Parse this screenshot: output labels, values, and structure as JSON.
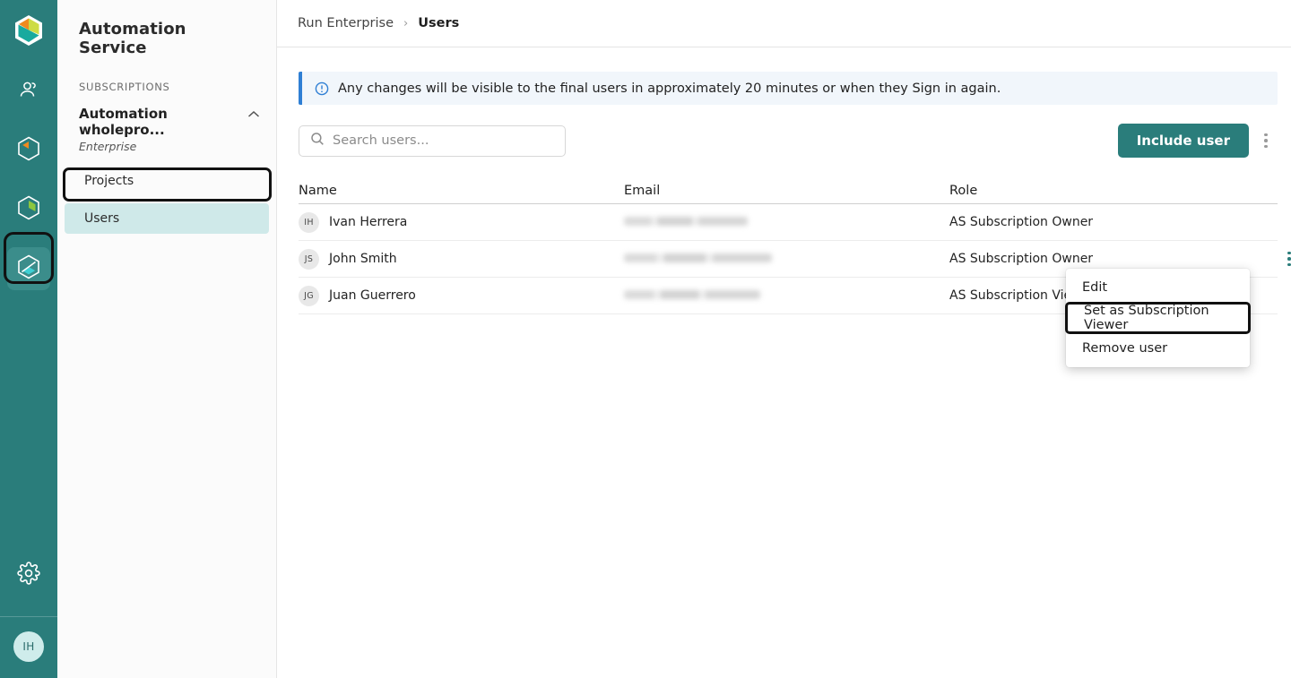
{
  "rail": {
    "logo_icon": "hexagon-logo-icon",
    "items": [
      {
        "name": "people-icon",
        "active": false
      },
      {
        "name": "hexagon-orange-icon",
        "active": false
      },
      {
        "name": "hexagon-green-icon",
        "active": false
      },
      {
        "name": "hexagon-teal-icon",
        "active": true
      }
    ],
    "settings_icon": "gear-icon",
    "avatar_initials": "IH"
  },
  "sidebar": {
    "title": "Automation Service",
    "section_label": "SUBSCRIPTIONS",
    "subscription": {
      "name": "Automation wholepro...",
      "plan": "Enterprise",
      "chevron": "chevron-up-icon"
    },
    "items": [
      {
        "label": "Projects",
        "selected": false
      },
      {
        "label": "Users",
        "selected": true
      }
    ]
  },
  "breadcrumb": {
    "parent": "Run Enterprise",
    "separator": "›",
    "current": "Users"
  },
  "banner": {
    "icon": "info-circle-icon",
    "text": "Any changes will be visible to the final users in approximately 20 minutes or when they Sign in again.",
    "accent_color": "#2f7fd4",
    "background_color": "#f1f6fb"
  },
  "toolbar": {
    "search_placeholder": "Search users...",
    "search_value": "",
    "search_icon": "search-icon",
    "include_user_label": "Include user",
    "include_user_color": "#2a7d7b",
    "overflow_icon": "kebab-menu-icon"
  },
  "table": {
    "columns": [
      "Name",
      "Email",
      "Role"
    ],
    "rows": [
      {
        "initials": "IH",
        "name": "Ivan Herrera",
        "email": "",
        "role": "AS Subscription Owner"
      },
      {
        "initials": "JS",
        "name": "John Smith",
        "email": "",
        "role": "AS Subscription Owner"
      },
      {
        "initials": "JG",
        "name": "Juan Guerrero",
        "email": "",
        "role": "AS Subscription Viewer"
      }
    ]
  },
  "context_menu": {
    "items": [
      {
        "label": "Edit",
        "highlighted": false
      },
      {
        "label": "Set as Subscription Viewer",
        "highlighted": true
      },
      {
        "label": "Remove user",
        "highlighted": false
      }
    ]
  }
}
